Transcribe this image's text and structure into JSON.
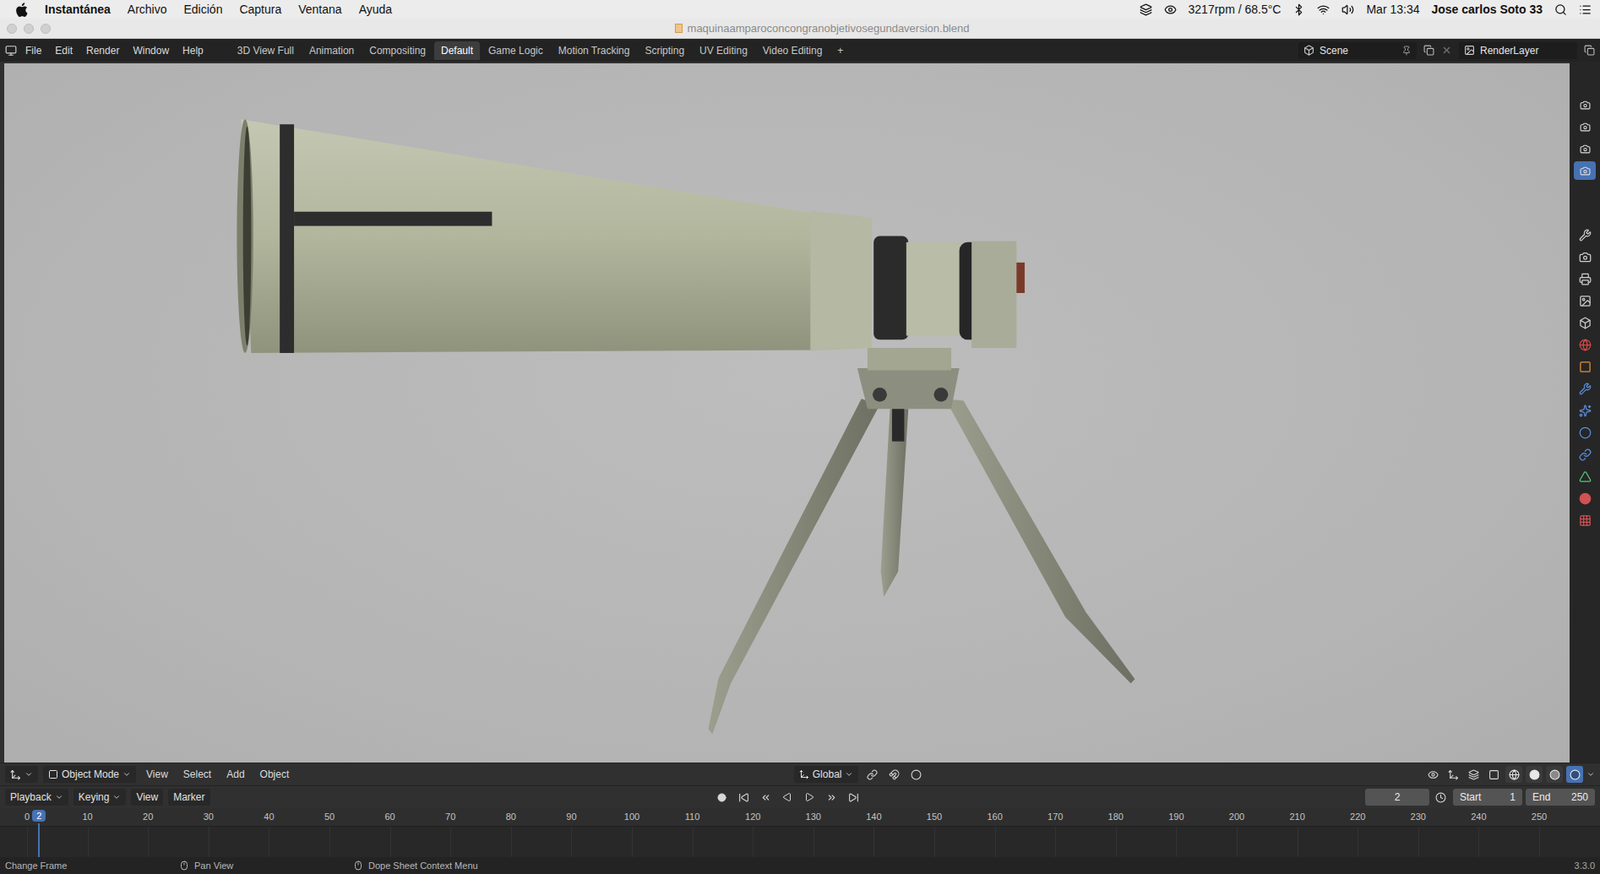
{
  "mac_menubar": {
    "app": "Instantánea",
    "menus": [
      "Archivo",
      "Edición",
      "Captura",
      "Ventana",
      "Ayuda"
    ],
    "fan": "3217rpm / 68.5°C",
    "clock": "Mar 13:34",
    "user": "Jose carlos Soto 33"
  },
  "window": {
    "title": "maquinaamparoconcongranobjetivosegundaversion.blend"
  },
  "topbar": {
    "menus": [
      "File",
      "Edit",
      "Render",
      "Window",
      "Help"
    ],
    "workspaces": [
      {
        "label": "3D View Full",
        "selected": false
      },
      {
        "label": "Animation",
        "selected": false
      },
      {
        "label": "Compositing",
        "selected": false
      },
      {
        "label": "Default",
        "selected": true
      },
      {
        "label": "Game Logic",
        "selected": false
      },
      {
        "label": "Motion Tracking",
        "selected": false
      },
      {
        "label": "Scripting",
        "selected": false
      },
      {
        "label": "UV Editing",
        "selected": false
      },
      {
        "label": "Video Editing",
        "selected": false
      }
    ],
    "add_tab": "+",
    "scene": "Scene",
    "view_layer": "RenderLayer"
  },
  "view_layer_tabs": [
    {
      "selected": false
    },
    {
      "selected": false
    },
    {
      "selected": false
    },
    {
      "selected": true
    }
  ],
  "properties_tabs": [
    {
      "kind": "tool"
    },
    {
      "kind": "render"
    },
    {
      "kind": "output"
    },
    {
      "kind": "viewlayer"
    },
    {
      "kind": "scene"
    },
    {
      "kind": "world"
    },
    {
      "kind": "object"
    },
    {
      "kind": "modifier"
    },
    {
      "kind": "particles"
    },
    {
      "kind": "physics"
    },
    {
      "kind": "constraints"
    },
    {
      "kind": "data"
    },
    {
      "kind": "material"
    },
    {
      "kind": "texture"
    }
  ],
  "viewport_header": {
    "mode": "Object Mode",
    "menus": [
      "View",
      "Select",
      "Add",
      "Object"
    ],
    "orientation": "Global",
    "shading": [
      {
        "kind": "wireframe",
        "selected": false
      },
      {
        "kind": "solid",
        "selected": false
      },
      {
        "kind": "material",
        "selected": false
      },
      {
        "kind": "rendered",
        "selected": true
      }
    ]
  },
  "timeline": {
    "menus": [
      "Playback",
      "Keying",
      "View",
      "Marker"
    ],
    "current_frame": "2",
    "start_label": "Start",
    "start": "1",
    "end_label": "End",
    "end": "250",
    "ticks": [
      "0",
      "10",
      "20",
      "30",
      "40",
      "50",
      "60",
      "70",
      "80",
      "90",
      "100",
      "110",
      "120",
      "130",
      "140",
      "150",
      "160",
      "170",
      "180",
      "190",
      "200",
      "210",
      "220",
      "230",
      "240",
      "250"
    ]
  },
  "status_bar": {
    "hints": [
      "Change Frame",
      "Pan View",
      "Dope Sheet Context Menu"
    ],
    "version": "3.3.0"
  }
}
